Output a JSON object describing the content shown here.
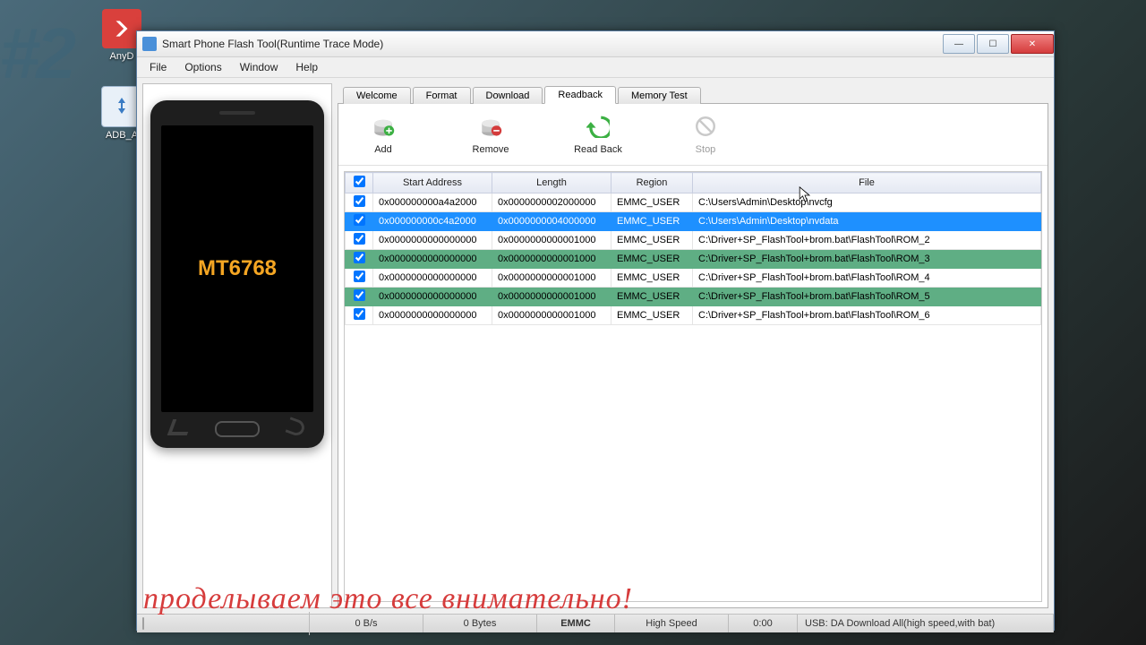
{
  "watermark": "#2",
  "desktop": [
    {
      "label": "AnyD",
      "color": "#d9403c",
      "icon": "◈"
    },
    {
      "label": "ADB_A",
      "color": "#3a7cc4",
      "icon": "⬍"
    }
  ],
  "window": {
    "title": "Smart Phone Flash Tool(Runtime Trace Mode)"
  },
  "menu": [
    "File",
    "Options",
    "Window",
    "Help"
  ],
  "phone_label": "MT6768",
  "tabs": [
    "Welcome",
    "Format",
    "Download",
    "Readback",
    "Memory Test"
  ],
  "active_tab": 3,
  "toolbar": [
    {
      "label": "Add",
      "kind": "add"
    },
    {
      "label": "Remove",
      "kind": "remove"
    },
    {
      "label": "Read Back",
      "kind": "readback"
    },
    {
      "label": "Stop",
      "kind": "stop",
      "disabled": true
    }
  ],
  "columns": [
    "",
    "Start Address",
    "Length",
    "Region",
    "File"
  ],
  "rows": [
    {
      "checked": true,
      "sel": false,
      "grn": false,
      "start": "0x000000000a4a2000",
      "len": "0x0000000002000000",
      "region": "EMMC_USER",
      "file": "C:\\Users\\Admin\\Desktop\\nvcfg"
    },
    {
      "checked": true,
      "sel": true,
      "grn": false,
      "start": "0x000000000c4a2000",
      "len": "0x0000000004000000",
      "region": "EMMC_USER",
      "file": "C:\\Users\\Admin\\Desktop\\nvdata"
    },
    {
      "checked": true,
      "sel": false,
      "grn": false,
      "start": "0x0000000000000000",
      "len": "0x0000000000001000",
      "region": "EMMC_USER",
      "file": "C:\\Driver+SP_FlashTool+brom.bat\\FlashTool\\ROM_2"
    },
    {
      "checked": true,
      "sel": false,
      "grn": true,
      "start": "0x0000000000000000",
      "len": "0x0000000000001000",
      "region": "EMMC_USER",
      "file": "C:\\Driver+SP_FlashTool+brom.bat\\FlashTool\\ROM_3"
    },
    {
      "checked": true,
      "sel": false,
      "grn": false,
      "start": "0x0000000000000000",
      "len": "0x0000000000001000",
      "region": "EMMC_USER",
      "file": "C:\\Driver+SP_FlashTool+brom.bat\\FlashTool\\ROM_4"
    },
    {
      "checked": true,
      "sel": false,
      "grn": true,
      "start": "0x0000000000000000",
      "len": "0x0000000000001000",
      "region": "EMMC_USER",
      "file": "C:\\Driver+SP_FlashTool+brom.bat\\FlashTool\\ROM_5"
    },
    {
      "checked": true,
      "sel": false,
      "grn": false,
      "start": "0x0000000000000000",
      "len": "0x0000000000001000",
      "region": "EMMC_USER",
      "file": "C:\\Driver+SP_FlashTool+brom.bat\\FlashTool\\ROM_6"
    }
  ],
  "status": {
    "rate": "0 B/s",
    "bytes": "0 Bytes",
    "storage": "EMMC",
    "speed": "High Speed",
    "time": "0:00",
    "usb": "USB: DA Download All(high speed,with bat)"
  },
  "footnote": "проделываем это все внимательно!"
}
